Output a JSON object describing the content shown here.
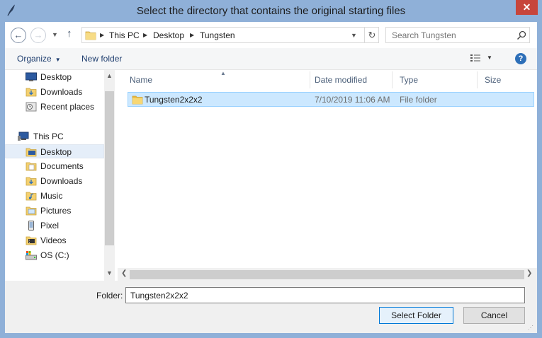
{
  "window": {
    "title": "Select the directory that contains the original starting files",
    "close_label": "✕"
  },
  "address": {
    "crumbs": [
      "This PC",
      "Desktop",
      "Tungsten"
    ],
    "search_placeholder": "Search Tungsten"
  },
  "toolbar": {
    "organize_label": "Organize",
    "new_folder_label": "New folder",
    "help_label": "?"
  },
  "nav": {
    "quick_items": [
      {
        "label": "Desktop",
        "icon": "desktop-icon"
      },
      {
        "label": "Downloads",
        "icon": "downloads-folder-icon"
      },
      {
        "label": "Recent places",
        "icon": "recent-places-icon"
      }
    ],
    "this_pc_label": "This PC",
    "pc_items": [
      {
        "label": "Desktop",
        "icon": "folder-icon",
        "selected": true
      },
      {
        "label": "Documents",
        "icon": "documents-folder-icon"
      },
      {
        "label": "Downloads",
        "icon": "downloads-folder-icon"
      },
      {
        "label": "Music",
        "icon": "music-folder-icon"
      },
      {
        "label": "Pictures",
        "icon": "pictures-folder-icon"
      },
      {
        "label": "Pixel",
        "icon": "phone-icon"
      },
      {
        "label": "Videos",
        "icon": "videos-folder-icon"
      },
      {
        "label": "OS (C:)",
        "icon": "drive-icon"
      }
    ]
  },
  "list": {
    "columns": [
      "Name",
      "Date modified",
      "Type",
      "Size"
    ],
    "rows": [
      {
        "name": "Tungsten2x2x2",
        "date": "7/10/2019 11:06 AM",
        "type": "File folder",
        "size": ""
      }
    ]
  },
  "footer": {
    "folder_label": "Folder:",
    "folder_value": "Tungsten2x2x2",
    "select_label": "Select Folder",
    "cancel_label": "Cancel"
  },
  "colors": {
    "titlebar": "#8fb0d8",
    "close": "#c7453b",
    "selection": "#cce8ff",
    "link": "#1e3d6e"
  }
}
